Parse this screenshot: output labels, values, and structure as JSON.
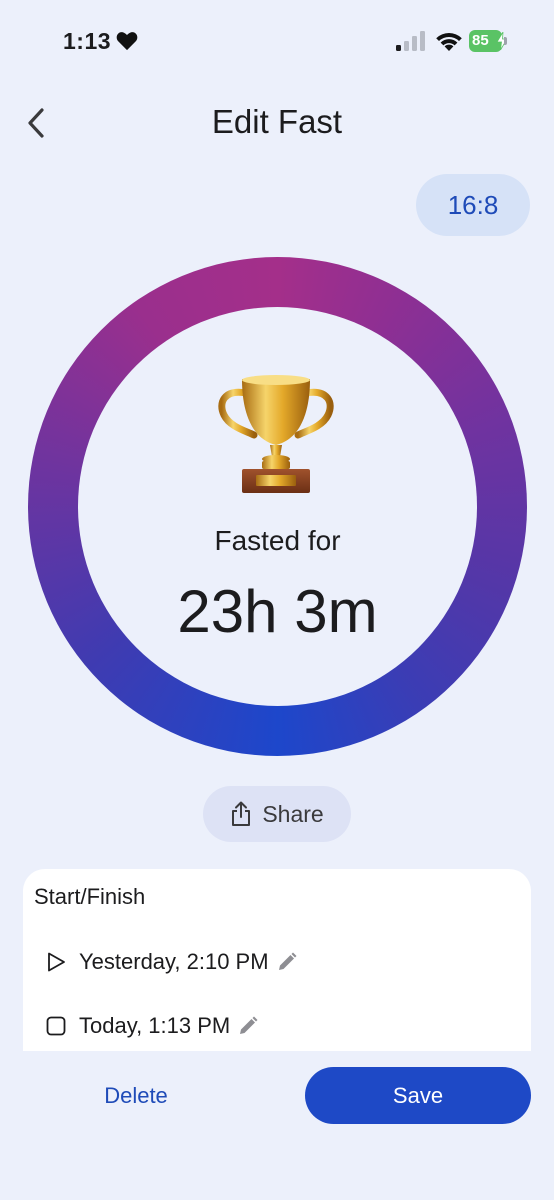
{
  "status_bar": {
    "time": "1:13",
    "battery_level": "85",
    "icons": [
      "heart-icon",
      "cellular-signal-icon",
      "wifi-icon",
      "battery-charging-icon"
    ]
  },
  "header": {
    "title": "Edit Fast",
    "back_icon": "chevron-left-icon"
  },
  "plan": {
    "label": "16:8"
  },
  "summary": {
    "icon": "trophy-icon",
    "label": "Fasted for",
    "duration": "23h 3m"
  },
  "share": {
    "label": "Share",
    "icon": "share-icon"
  },
  "schedule": {
    "title": "Start/Finish",
    "start": {
      "label": "Yesterday, 2:10 PM",
      "icon": "play-icon"
    },
    "finish": {
      "label": "Today, 1:13 PM",
      "icon": "stop-icon"
    },
    "edit_icon": "pencil-icon"
  },
  "actions": {
    "delete_label": "Delete",
    "save_label": "Save"
  },
  "colors": {
    "background": "#ecf0fb",
    "accent": "#1e49c6",
    "ring_start": "#a42f8a",
    "ring_end": "#1d47cb",
    "chip_background": "#d6e2f7"
  }
}
